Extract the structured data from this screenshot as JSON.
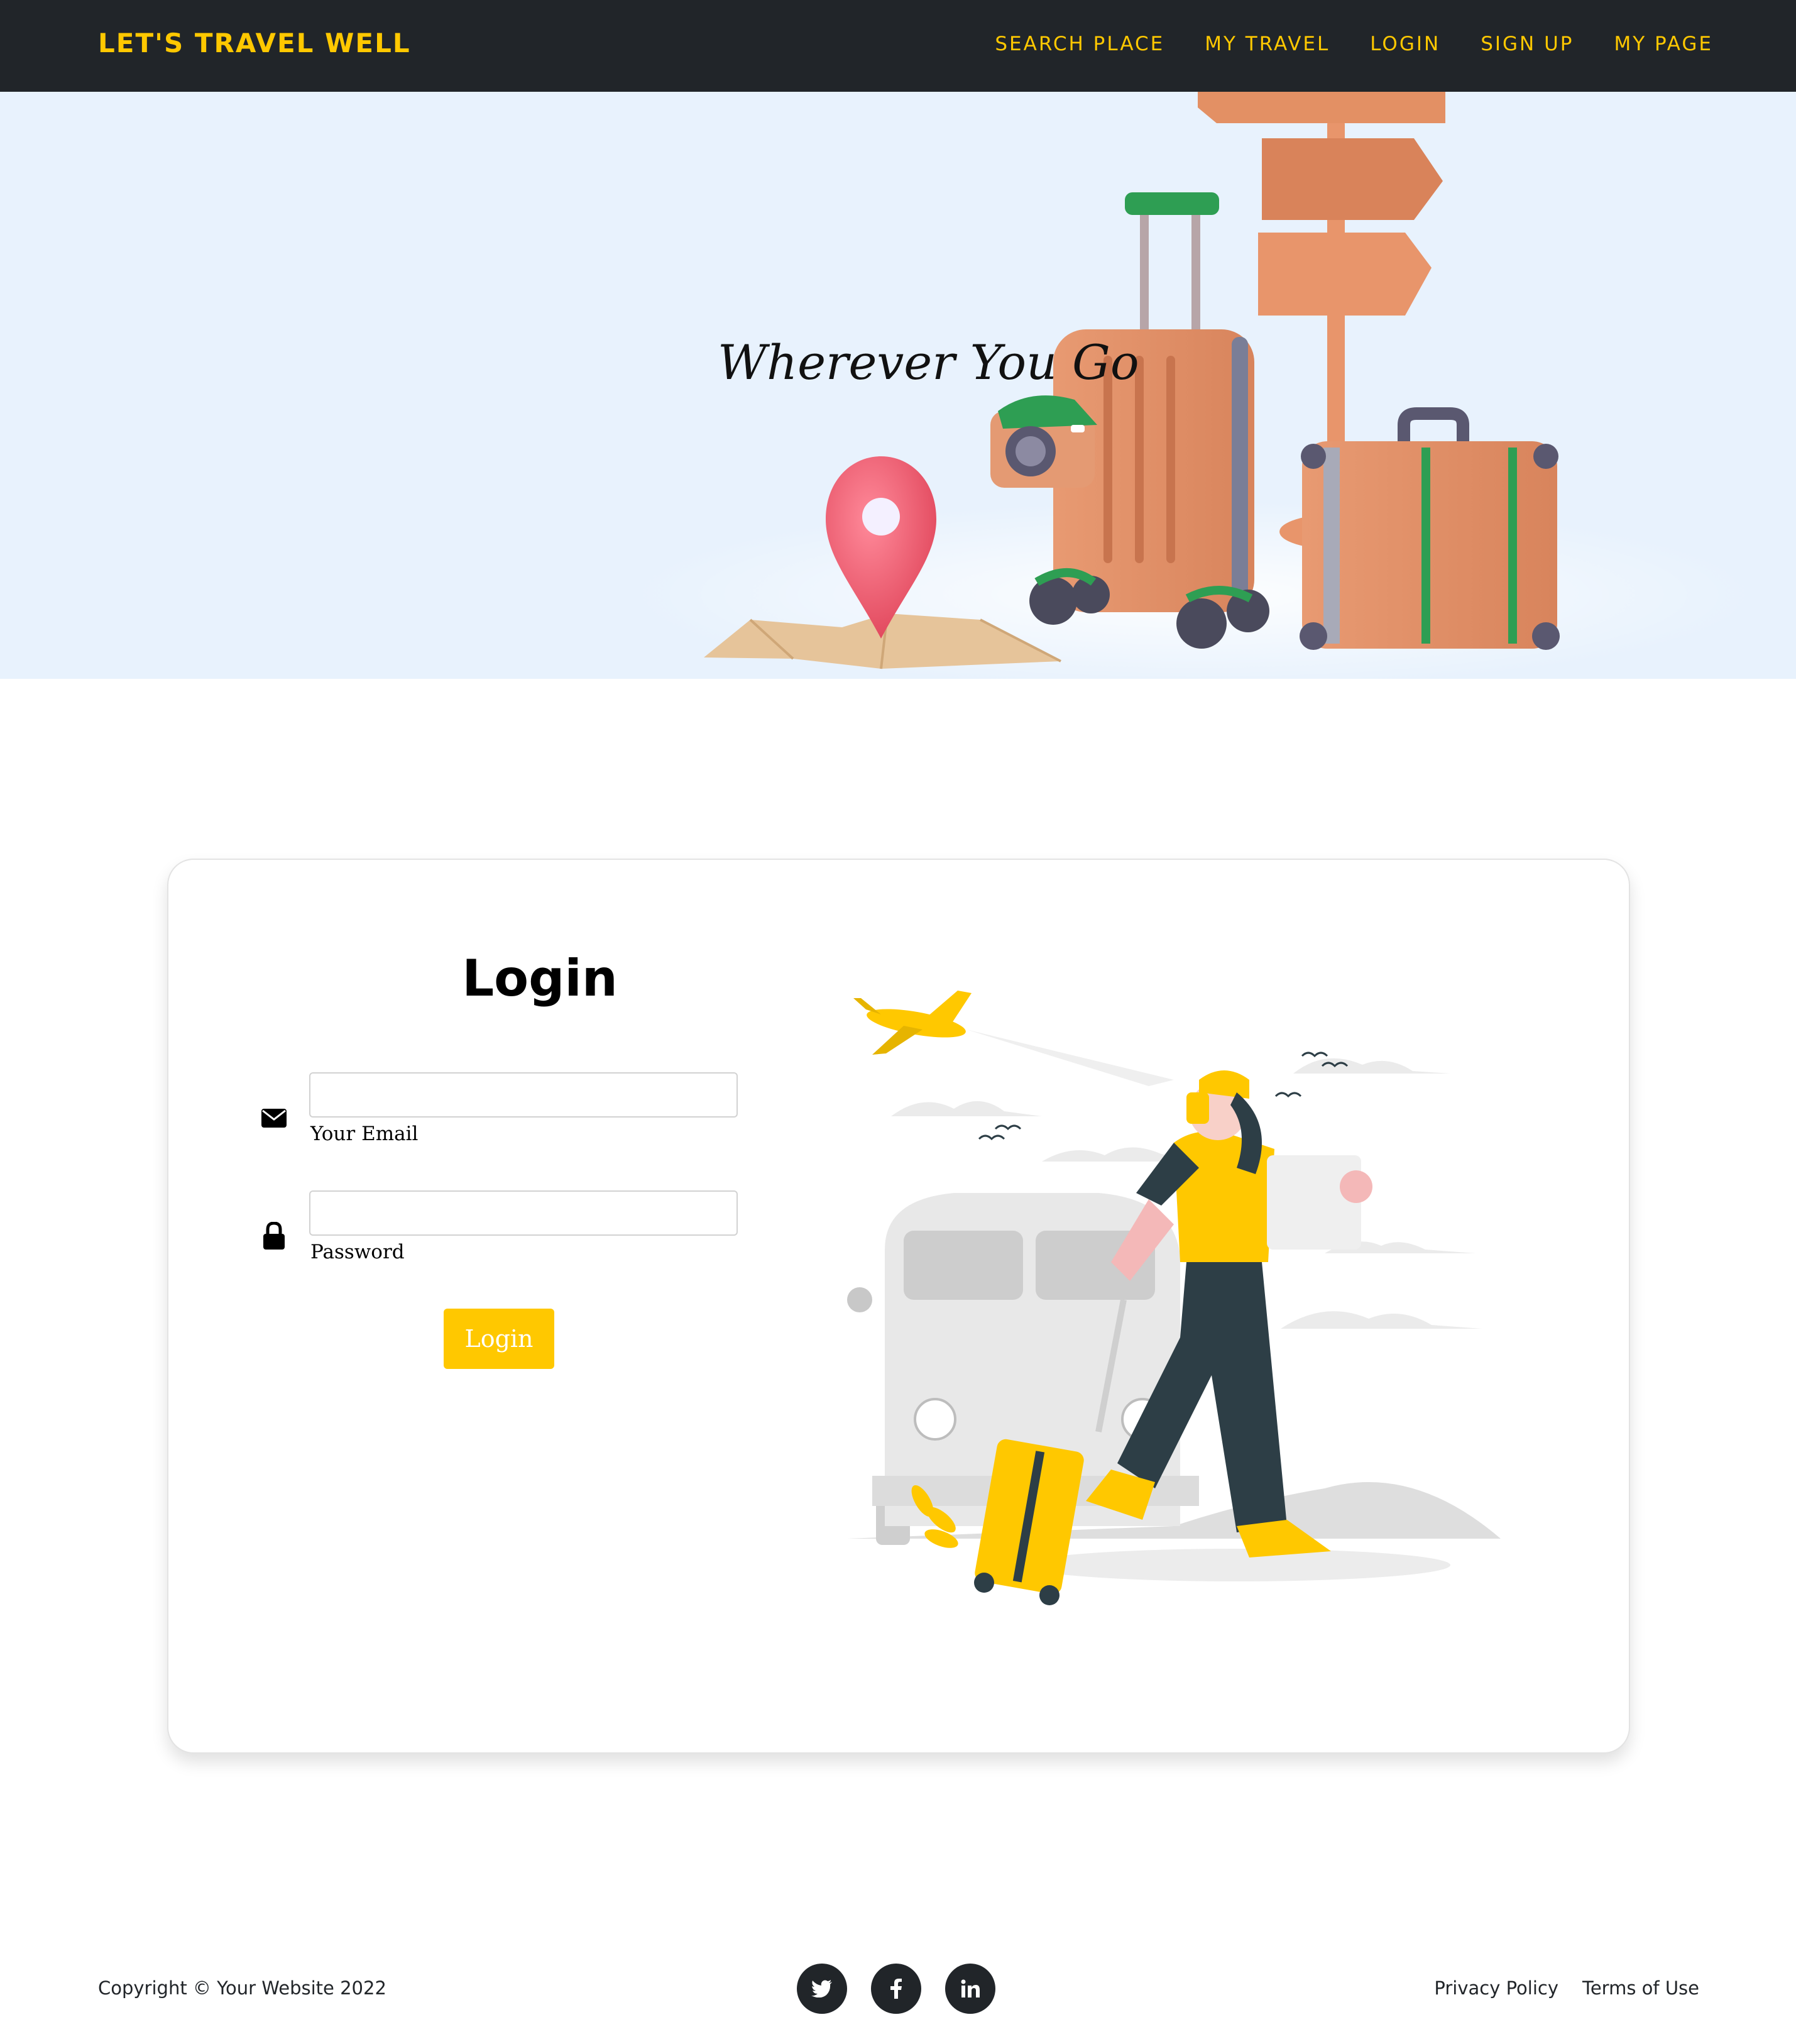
{
  "navbar": {
    "brand": "LET'S TRAVEL WELL",
    "links": [
      "SEARCH PLACE",
      "MY TRAVEL",
      "LOGIN",
      "SIGN UP",
      "MY PAGE"
    ]
  },
  "hero": {
    "title": "Wherever You Go"
  },
  "login": {
    "title": "Login",
    "email_label": "Your Email",
    "email_value": "",
    "password_label": "Password",
    "password_value": "",
    "button_label": "Login"
  },
  "footer": {
    "copyright": "Copyright © Your Website 2022",
    "social_icons": [
      "twitter-icon",
      "facebook-icon",
      "linkedin-icon"
    ],
    "links": [
      "Privacy Policy",
      "Terms of Use"
    ]
  },
  "colors": {
    "accent": "#ffc800",
    "navbar_bg": "#212529",
    "hero_bg": "#e8f2fd"
  }
}
